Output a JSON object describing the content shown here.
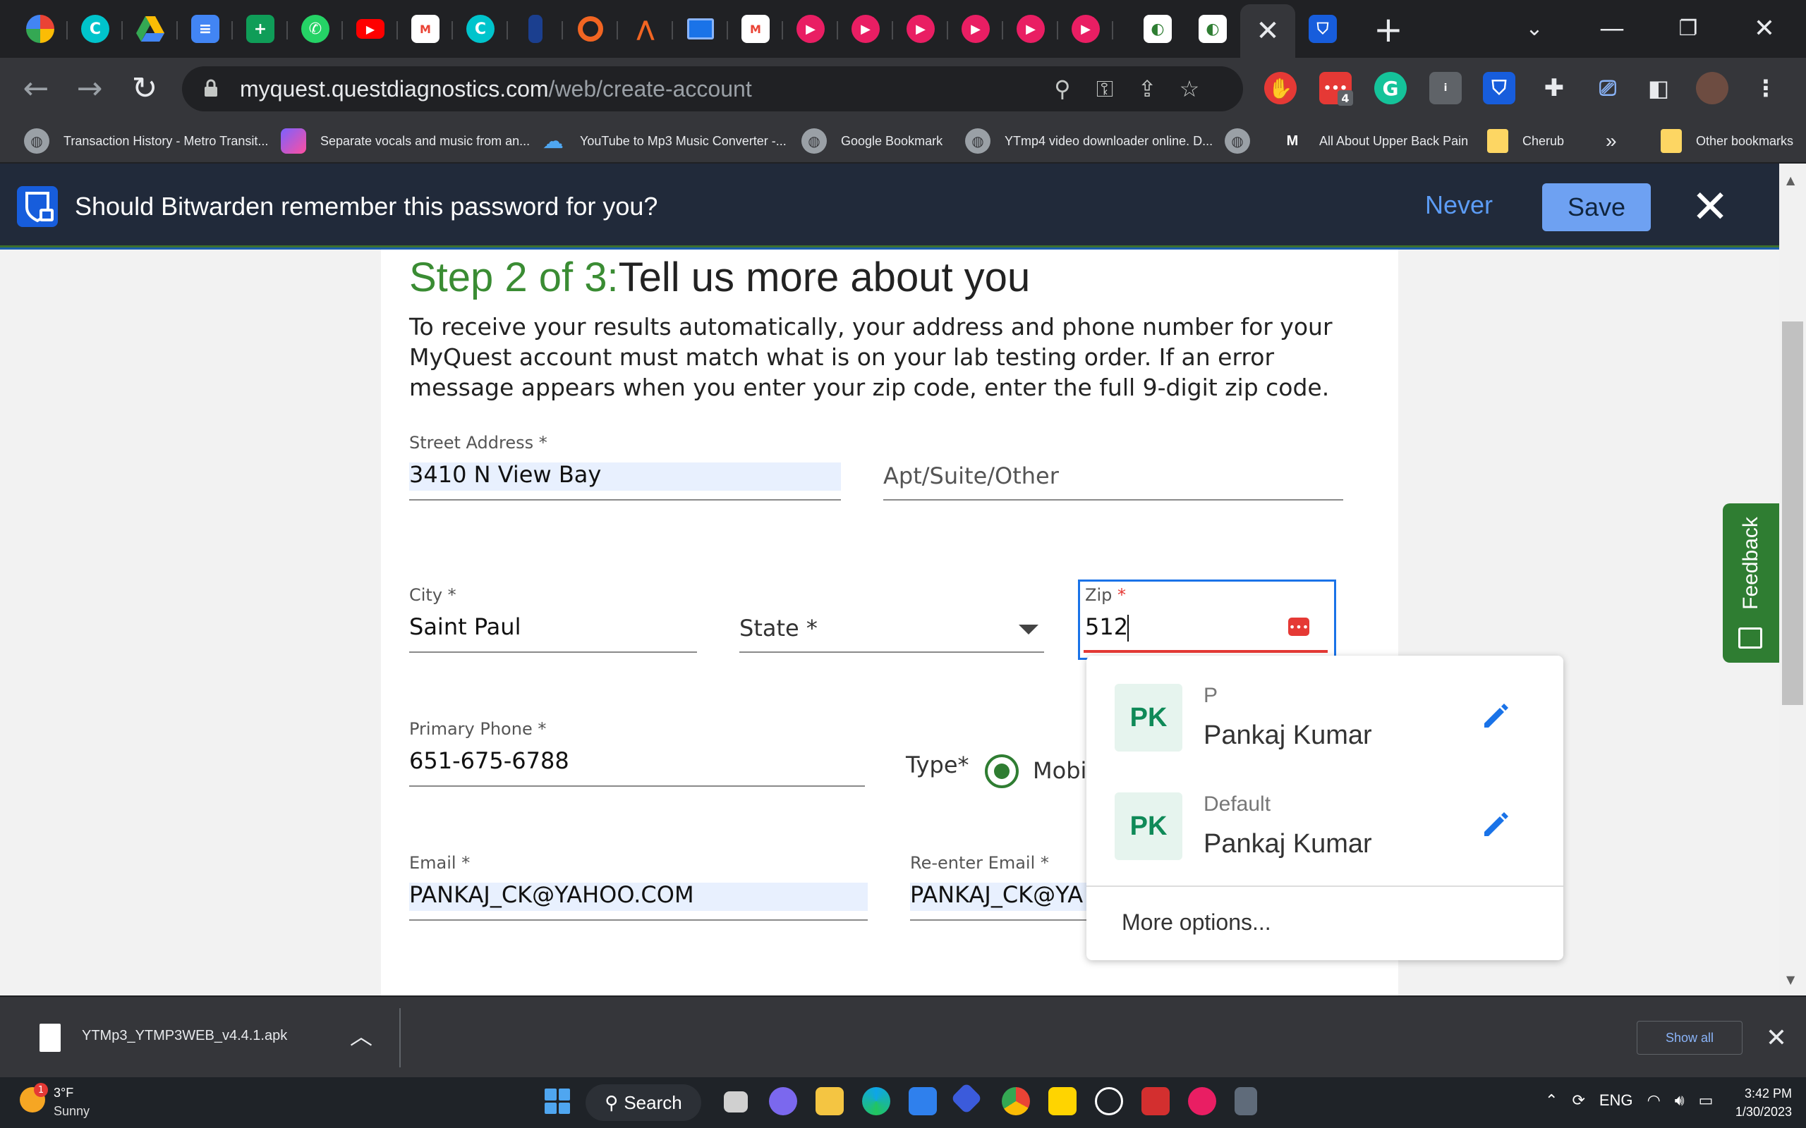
{
  "browser": {
    "active_tab_close": "✕",
    "new_tab": "+",
    "url_host": "myquest.questdiagnostics.com",
    "url_path": "/web/create-account",
    "extension_badge": "4"
  },
  "bookmarks": [
    {
      "label": "Transaction History - Metro Transit..."
    },
    {
      "label": "Separate vocals and music from an..."
    },
    {
      "label": "YouTube to Mp3 Music Converter -..."
    },
    {
      "label": "Google Bookmark"
    },
    {
      "label": "YTmp4 video downloader online. D..."
    },
    {
      "label": "All About Upper Back Pain"
    },
    {
      "label": "Cherub"
    },
    {
      "label": "Other bookmarks"
    }
  ],
  "bitwarden": {
    "question": "Should Bitwarden remember this password for you?",
    "never_label": "Never",
    "save_label": "Save"
  },
  "form": {
    "step_prefix": "Step 2 of 3:",
    "step_title": "Tell us more about you",
    "intro": "To receive your results automatically, your address and phone number for your MyQuest account must match what is on your lab testing order. If an error message appears when you enter your zip code, enter the full 9-digit zip code.",
    "street_label": "Street Address *",
    "street_value": "3410 N View Bay",
    "apt_placeholder": "Apt/Suite/Other",
    "city_label": "City *",
    "city_value": "Saint Paul",
    "state_placeholder": "State *",
    "zip_label": "Zip",
    "zip_required": "*",
    "zip_value": "512",
    "phone_label": "Primary Phone *",
    "phone_value": "651-675-6788",
    "type_label": "Type*",
    "type_option": "Mobi",
    "email_label": "Email *",
    "email_value": "PANKAJ_CK@YAHOO.COM",
    "reemail_label": "Re-enter Email *",
    "reemail_value": "PANKAJ_CK@YA"
  },
  "autofill": {
    "items": [
      {
        "initials": "PK",
        "subtitle": "P",
        "name": "Pankaj Kumar"
      },
      {
        "initials": "PK",
        "subtitle": "Default",
        "name": "Pankaj Kumar"
      }
    ],
    "more_label": "More options..."
  },
  "feedback_label": "Feedback",
  "downloads": {
    "file_name": "YTMp3_YTMP3WEB_v4.4.1.apk",
    "show_all": "Show all"
  },
  "taskbar": {
    "weather_badge": "1",
    "temp": "3°F",
    "condition": "Sunny",
    "search_label": "Search",
    "lang": "ENG",
    "time": "3:42 PM",
    "date": "1/30/2023"
  },
  "colors": {
    "accent_green": "#3a8c33",
    "focus_blue": "#1a73e8",
    "error_red": "#e53935",
    "bitwarden_blue": "#175ddc"
  }
}
